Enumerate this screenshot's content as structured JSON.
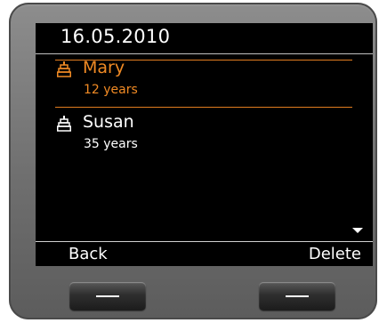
{
  "header": {
    "date": "16.05.2010"
  },
  "entries": [
    {
      "name": "Mary",
      "detail": "12 years",
      "icon": "cake-icon",
      "selected": true
    },
    {
      "name": "Susan",
      "detail": "35 years",
      "icon": "cake-icon",
      "selected": false
    }
  ],
  "softkeys": {
    "left_label": "Back",
    "right_label": "Delete"
  },
  "colors": {
    "highlight": "#f08a24",
    "screen_background": "#000000",
    "text": "#ffffff"
  }
}
